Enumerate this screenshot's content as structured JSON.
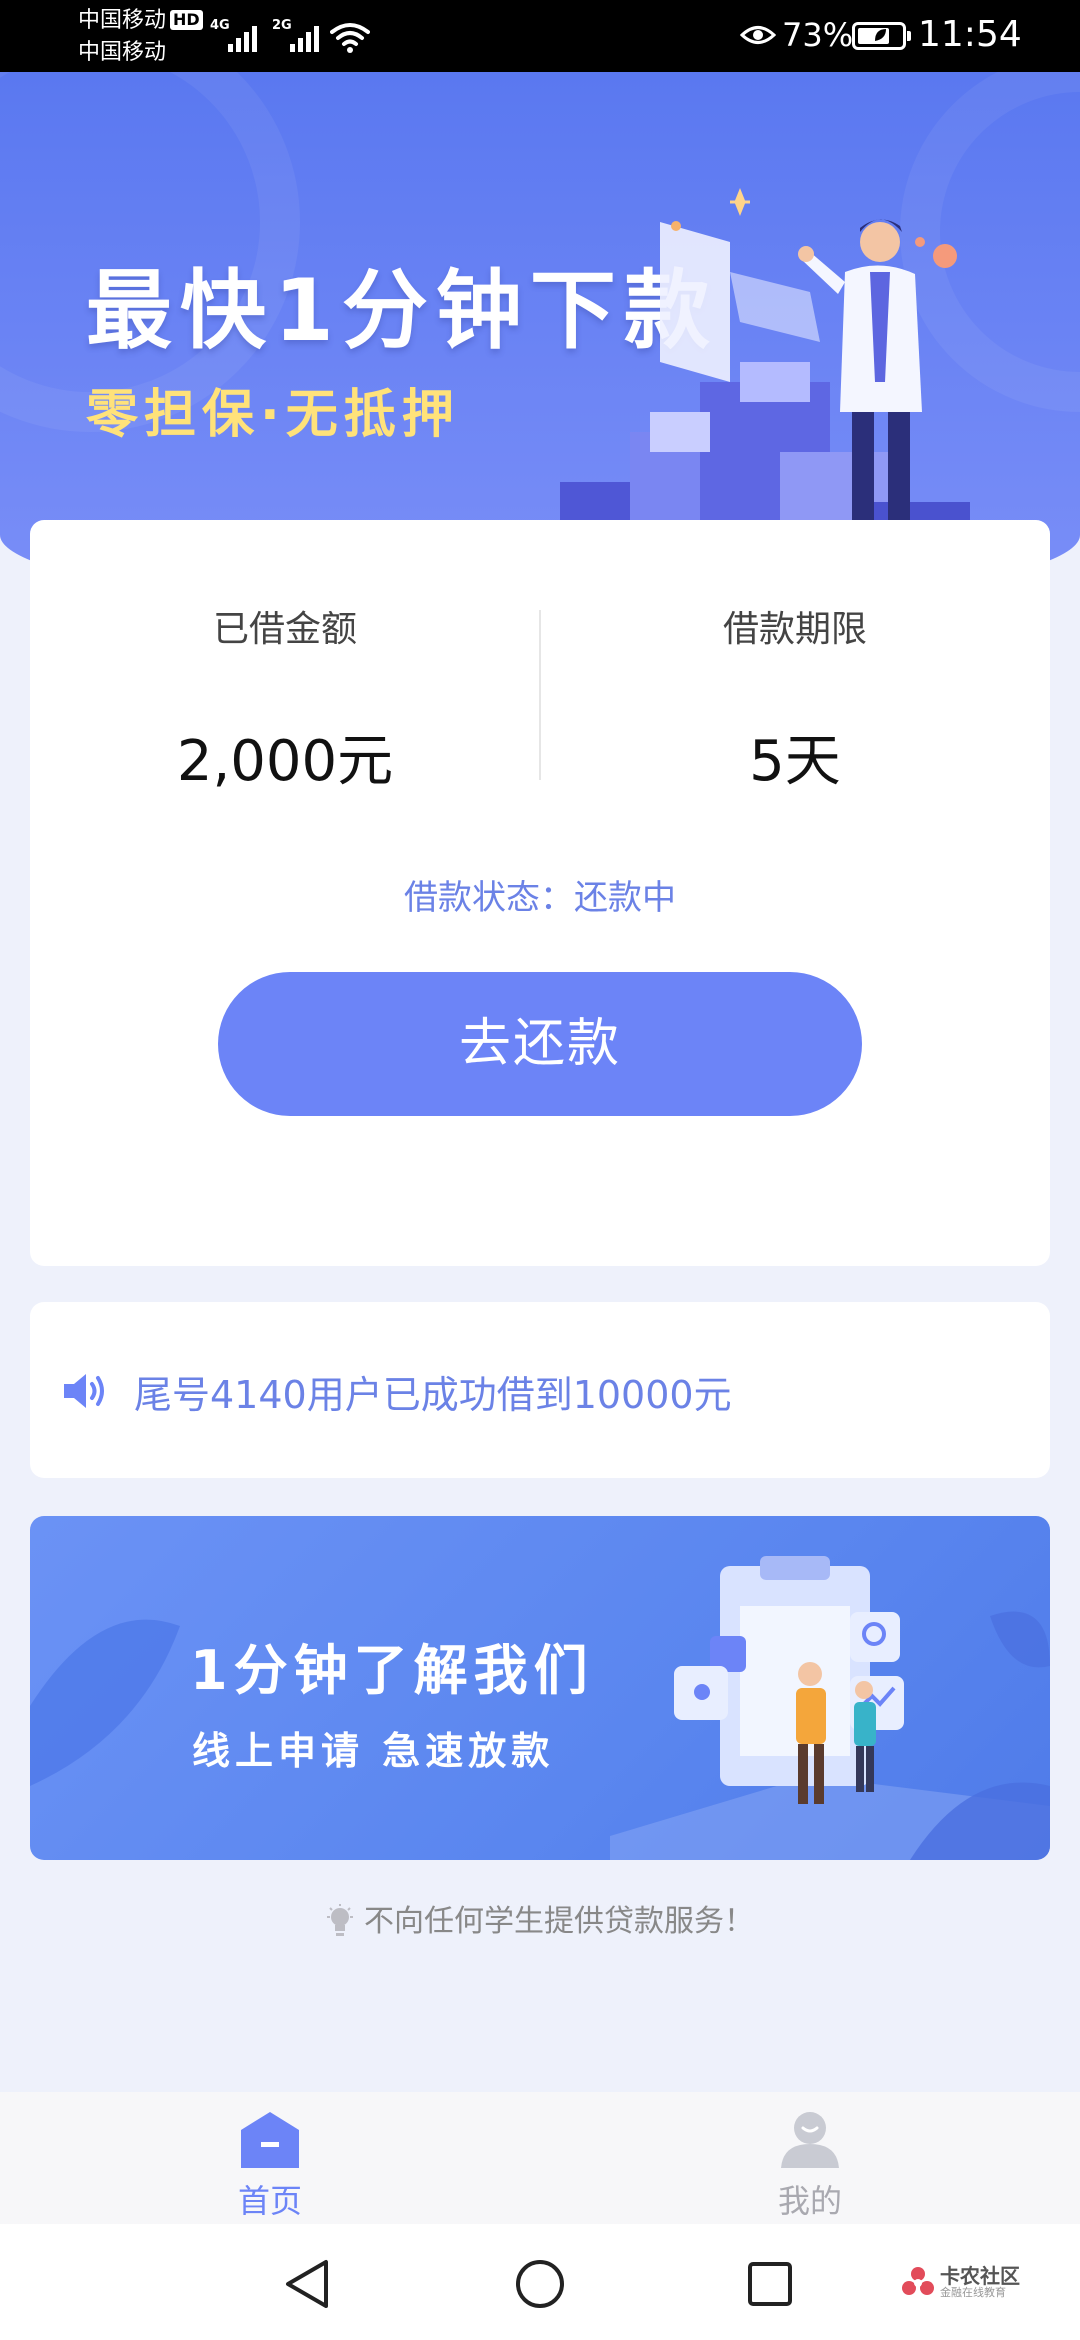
{
  "status_bar": {
    "carrier_1": "中国移动",
    "hd": "HD",
    "carrier_2": "中国移动",
    "net_1": "4G",
    "net_2": "2G",
    "battery_percent": "73%",
    "battery_level": 0.73,
    "time": "11:54"
  },
  "hero": {
    "title": "最快1分钟下款",
    "subtitle": "零担保·无抵押"
  },
  "loan": {
    "amount_label": "已借金额",
    "amount_value": "2,000元",
    "term_label": "借款期限",
    "term_value": "5天",
    "status": "借款状态：还款中",
    "repay_button": "去还款"
  },
  "notice": {
    "text": "尾号4140用户已成功借到10000元"
  },
  "promo": {
    "title": "1分钟了解我们",
    "subtitle": "线上申请  急速放款"
  },
  "disclaimer": "不向任何学生提供贷款服务！",
  "tabs": [
    {
      "label": "首页",
      "icon": "home-icon",
      "active": true
    },
    {
      "label": "我的",
      "icon": "user-icon",
      "active": false
    }
  ],
  "watermark": {
    "main": "卡农社区",
    "sub": "金融在线教育"
  },
  "colors": {
    "accent": "#6c84f7",
    "hero_top": "#5a78f0",
    "subtitle_gold": "#ffe27a",
    "status_text": "#6b82e6"
  }
}
